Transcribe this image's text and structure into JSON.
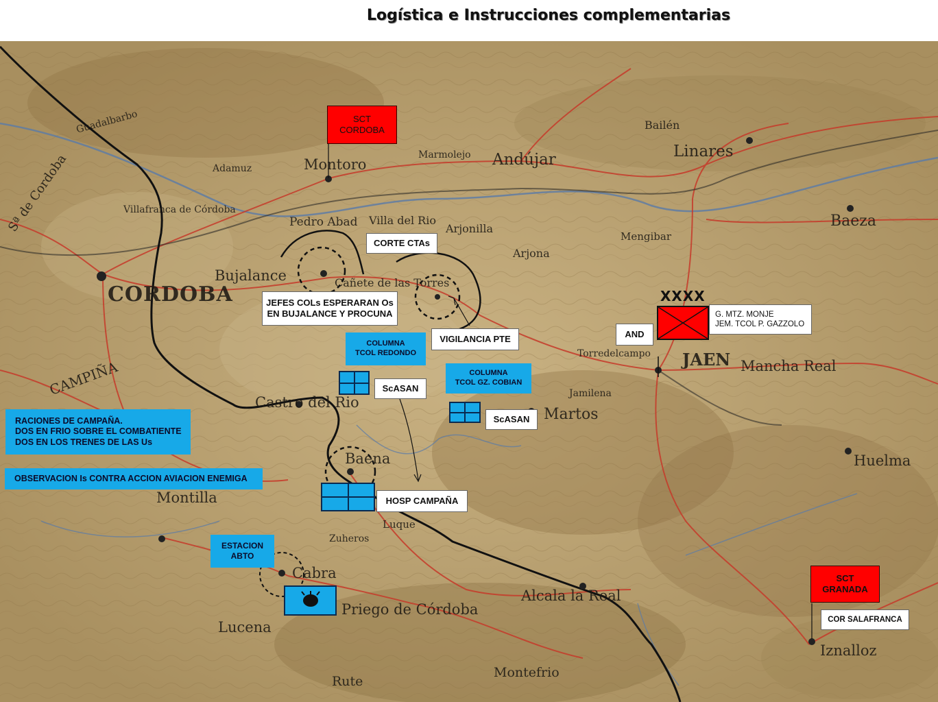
{
  "title": "Logística e Instrucciones complementarias",
  "places": [
    {
      "id": "montoro",
      "text": "Montoro"
    },
    {
      "id": "andujar",
      "text": "Andújar"
    },
    {
      "id": "linares",
      "text": "Linares"
    },
    {
      "id": "baeza",
      "text": "Baeza"
    },
    {
      "id": "cordoba",
      "text": "CORDOBA"
    },
    {
      "id": "bujalance",
      "text": "Bujalance"
    },
    {
      "id": "pedro-abad",
      "text": "Pedro Abad"
    },
    {
      "id": "villa-del-rio",
      "text": "Villa del Rio"
    },
    {
      "id": "arjonilla",
      "text": "Arjonilla"
    },
    {
      "id": "arjona",
      "text": "Arjona"
    },
    {
      "id": "marmolejo",
      "text": "Marmolejo"
    },
    {
      "id": "canete",
      "text": "Cañete de las Torres"
    },
    {
      "id": "castro",
      "text": "Castro del Rio"
    },
    {
      "id": "baena",
      "text": "Baena"
    },
    {
      "id": "martos",
      "text": "Martos"
    },
    {
      "id": "jaen",
      "text": "JAEN"
    },
    {
      "id": "mancha-real",
      "text": "Mancha Real"
    },
    {
      "id": "montilla",
      "text": "Montilla"
    },
    {
      "id": "cabra",
      "text": "Cabra"
    },
    {
      "id": "lucena",
      "text": "Lucena"
    },
    {
      "id": "priego",
      "text": "Priego de Córdoba"
    },
    {
      "id": "alcala",
      "text": "Alcala la Real"
    },
    {
      "id": "huelma",
      "text": "Huelma"
    },
    {
      "id": "iznalloz",
      "text": "Iznalloz"
    },
    {
      "id": "montefrio",
      "text": "Montefrio"
    },
    {
      "id": "rute",
      "text": "Rute"
    },
    {
      "id": "campina",
      "text": "CAMPIÑA"
    },
    {
      "id": "villafranca",
      "text": "Villafranca de Córdoba"
    },
    {
      "id": "mengibar",
      "text": "Mengibar"
    },
    {
      "id": "bailen",
      "text": "Bailén"
    },
    {
      "id": "jamilena",
      "text": "Jamilena"
    },
    {
      "id": "torredelcampo",
      "text": "Torredelcampo"
    },
    {
      "id": "luque",
      "text": "Luque"
    },
    {
      "id": "zuheros",
      "text": "Zuheros"
    },
    {
      "id": "sa-cordoba",
      "text": "Sª de Cordoba"
    },
    {
      "id": "adamuz",
      "text": "Adamuz"
    },
    {
      "id": "guadalupe",
      "text": "Guadalbarbo"
    }
  ],
  "labels": {
    "sct_cordoba": "SCT\nCORDOBA",
    "corte_ctas": "CORTE CTAs",
    "jefes_cols": "JEFES COLs ESPERARAN Os\nEN BUJALANCE Y PROCUNA",
    "vigilancia": "VIGILANCIA PTE",
    "columna_redondo": "COLUMNA\nTCOL REDONDO",
    "columna_cobian": "COLUMNA\nTCOL GZ. COBIAN",
    "scasan_1": "ScASAN",
    "scasan_2": "ScASAN",
    "raciones": "RACIONES DE CAMPAÑA.\nDOS EN FRIO SOBRE EL COMBATIENTE\nDOS EN LOS TRENES DE LAS Us",
    "observacion": "OBSERVACION Is CONTRA ACCION AVIACION ENEMIGA",
    "hosp": "HOSP CAMPAÑA",
    "estacion": "ESTACION\nABTO",
    "and": "AND",
    "mando": "G. MTZ. MONJE\nJEM. TCOL P. GAZZOLO",
    "xxxx": "XXXX",
    "sct_granada": "SCT\nGRANADA",
    "cor_salafranca": "COR SALAFRANCA"
  },
  "colors": {
    "map_base": "#b59e6e",
    "road": "#c63a2a",
    "river": "#5a7aa8",
    "symbol_blue": "#17a9e8",
    "symbol_red": "#ff0000"
  }
}
